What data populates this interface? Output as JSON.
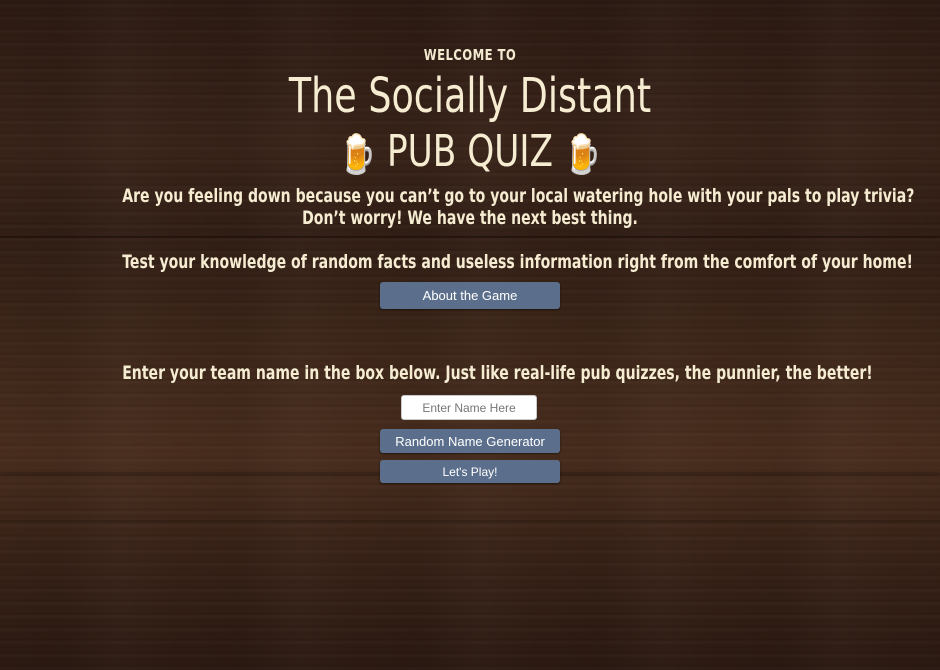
{
  "header": {
    "welcome": "WELCOME TO",
    "title": "The Socially Distant",
    "subtitle": "PUB QUIZ",
    "mug_icon": "beer-mug-icon"
  },
  "intro": {
    "line1": "Are you feeling down because you can’t go to your local watering hole with your pals to play trivia?",
    "line2": "Don’t worry! We have the next best thing.",
    "line3": "Test your knowledge of random facts and useless information right from the comfort of your home!",
    "about_button": "About the Game"
  },
  "team": {
    "prompt": "Enter your team name in the box below. Just like real-life pub quizzes, the punnier, the better!",
    "name_placeholder": "Enter Name Here",
    "name_value": "",
    "random_button": "Random Name Generator",
    "play_button": "Let's Play!"
  },
  "theme": {
    "button_color": "#5b6f8c",
    "text_color": "#f5ecd2",
    "background": "dark wood"
  }
}
